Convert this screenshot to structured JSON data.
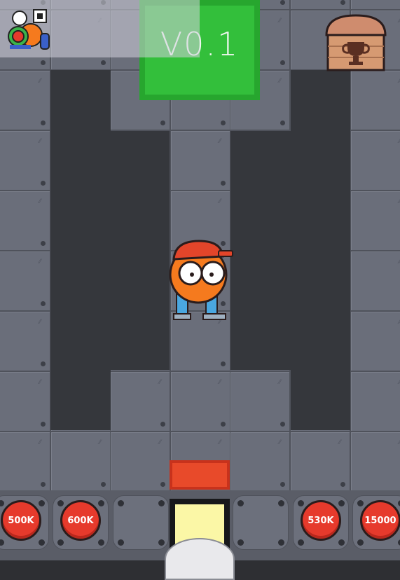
{
  "game": {
    "version_label": "V0.1",
    "colors": {
      "floor": "#6a6e7a",
      "pit": "#35373c",
      "exit": "#33bf3b",
      "barrier": "#e84a2a",
      "price_button": "#e63a2c",
      "player_body": "#f57a1e",
      "player_cap": "#e3452a",
      "player_legs": "#4aa7e0"
    }
  },
  "hud": {
    "logo_icon": "game-logo-icon",
    "chest_icon": "trophy-chest-icon"
  },
  "shop": {
    "slots": [
      {
        "price": "500K"
      },
      {
        "price": "600K"
      },
      {
        "price": ""
      },
      {
        "price": ""
      },
      {
        "price": ""
      },
      {
        "price": "530K"
      },
      {
        "price": "15000"
      }
    ]
  }
}
